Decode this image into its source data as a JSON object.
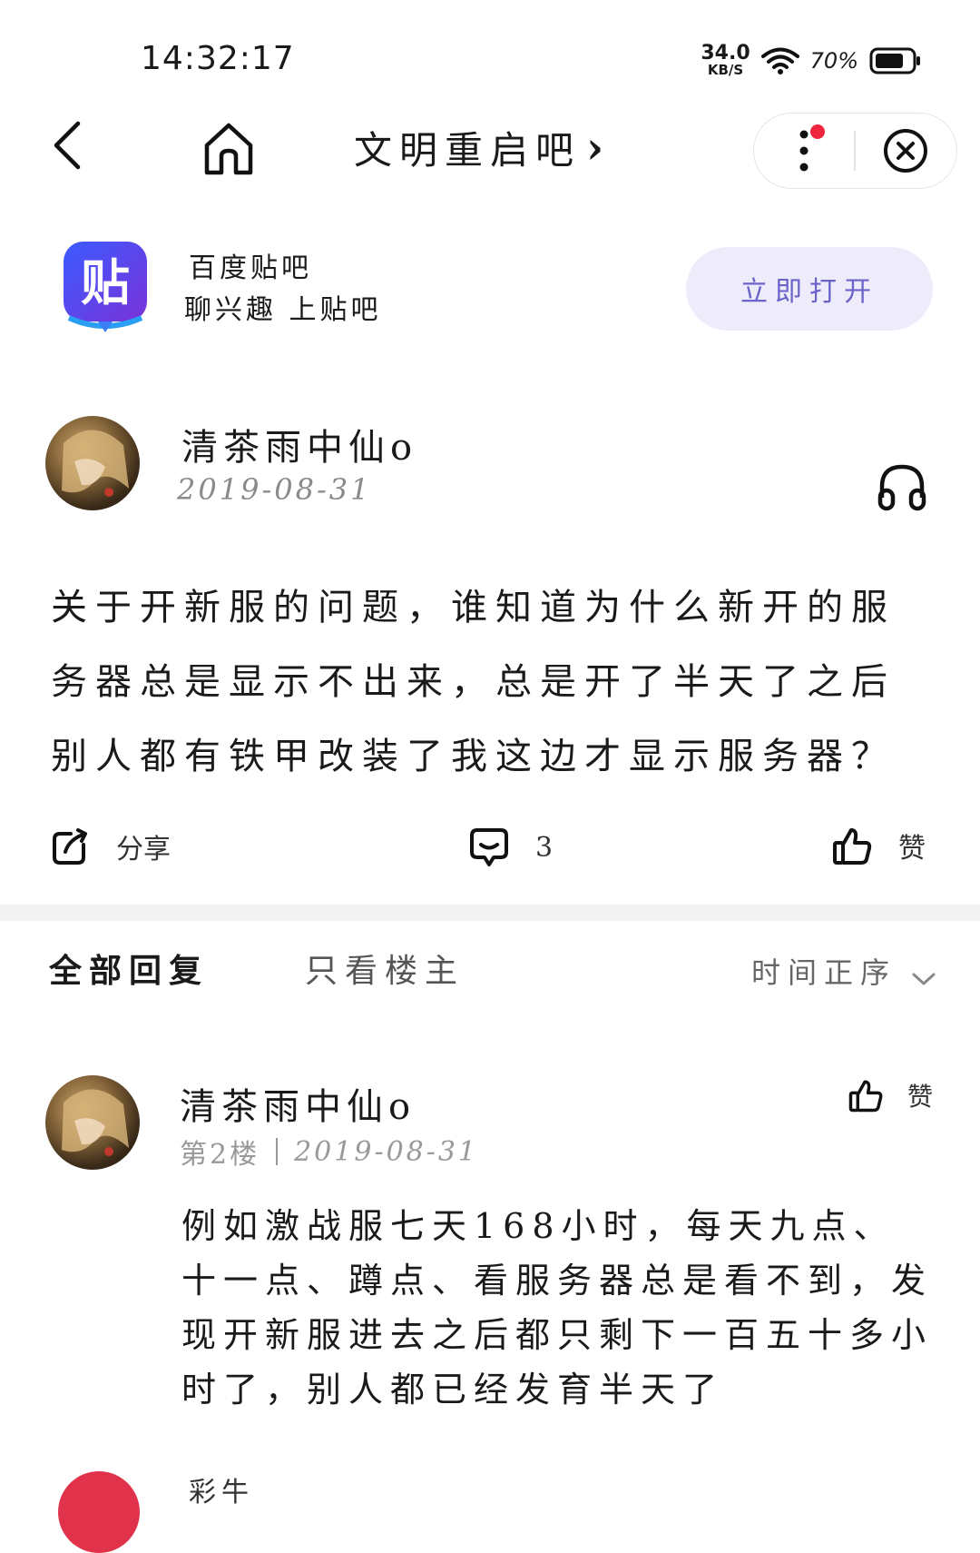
{
  "status_bar": {
    "time": "14:32:17",
    "net_speed_value": "34.0",
    "net_speed_unit": "KB/S",
    "battery_percent": "70%"
  },
  "nav": {
    "title": "文明重启吧",
    "title_chevron": "›"
  },
  "app_banner": {
    "logo_text": "贴",
    "name": "百度贴吧",
    "slogan": "聊兴趣 上贴吧",
    "open_button": "立即打开"
  },
  "post": {
    "author": "清茶雨中仙o",
    "date": "2019-08-31",
    "content": "关于开新服的问题，谁知道为什么新开的服务器总是显示不出来，总是开了半天了之后别人都有铁甲改装了我这边才显示服务器？",
    "actions": {
      "share_label": "分享",
      "comment_count": "3",
      "like_label": "赞"
    }
  },
  "reply_tabs": {
    "all": "全部回复",
    "owner_only": "只看楼主",
    "sort": "时间正序"
  },
  "replies": [
    {
      "author": "清茶雨中仙o",
      "floor": "第2楼",
      "date": "2019-08-31",
      "like_label": "赞",
      "content": "例如激战服七天168小时，每天九点、十一点、蹲点、看服务器总是看不到，发现开新服进去之后都只剩下一百五十多小时了，别人都已经发育半天了"
    }
  ],
  "next_reply": {
    "author_partial": "彩牛"
  },
  "colors": {
    "accent": "#6a63c9",
    "button_bg": "#eeecfb",
    "notification_dot": "#f0263d",
    "divider_band": "#f2f2f2",
    "muted_text": "#8a8a8a"
  }
}
